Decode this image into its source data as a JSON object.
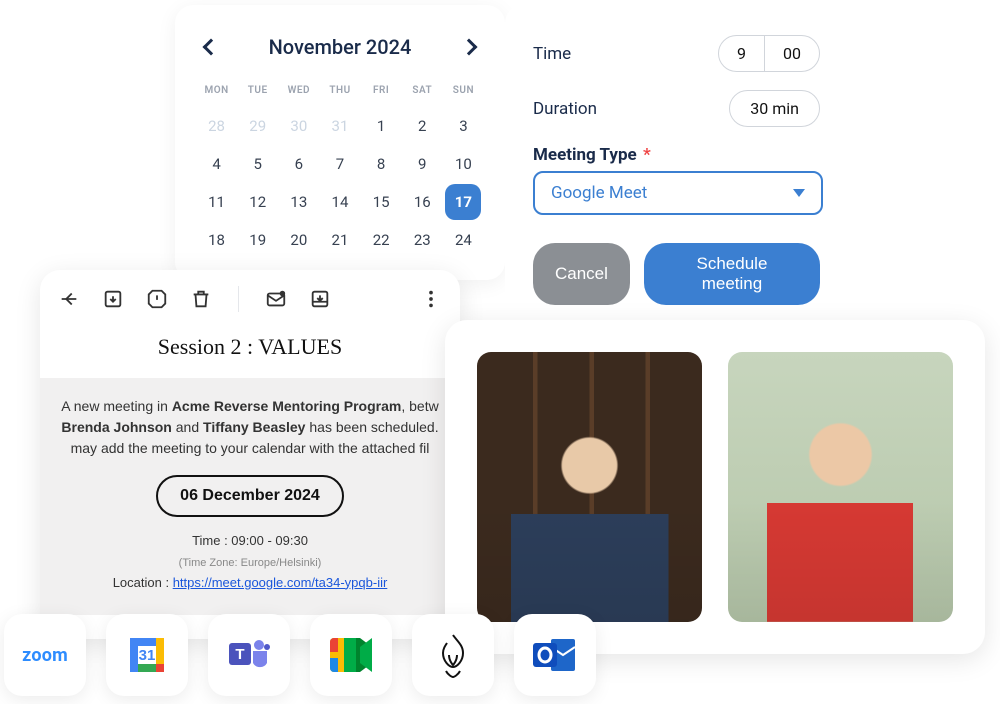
{
  "calendar": {
    "month_label": "November 2024",
    "dow": [
      "MON",
      "TUE",
      "WED",
      "THU",
      "FRI",
      "SAT",
      "SUN"
    ],
    "cells": [
      {
        "n": "28",
        "muted": true
      },
      {
        "n": "29",
        "muted": true
      },
      {
        "n": "30",
        "muted": true
      },
      {
        "n": "31",
        "muted": true
      },
      {
        "n": "1"
      },
      {
        "n": "2"
      },
      {
        "n": "3"
      },
      {
        "n": "4"
      },
      {
        "n": "5"
      },
      {
        "n": "6"
      },
      {
        "n": "7"
      },
      {
        "n": "8"
      },
      {
        "n": "9"
      },
      {
        "n": "10"
      },
      {
        "n": "11"
      },
      {
        "n": "12"
      },
      {
        "n": "13"
      },
      {
        "n": "14"
      },
      {
        "n": "15"
      },
      {
        "n": "16"
      },
      {
        "n": "17",
        "selected": true
      },
      {
        "n": "18"
      },
      {
        "n": "19"
      },
      {
        "n": "20"
      },
      {
        "n": "21"
      },
      {
        "n": "22"
      },
      {
        "n": "23"
      },
      {
        "n": "24"
      }
    ]
  },
  "form": {
    "time_label": "Time",
    "hour": "9",
    "minute": "00",
    "duration_label": "Duration",
    "duration_value": "30 min",
    "meeting_type_label": "Meeting Type",
    "meeting_type_value": "Google Meet",
    "cancel_label": "Cancel",
    "schedule_label": "Schedule meeting"
  },
  "email": {
    "title": "Session 2 : VALUES",
    "line1_pre": "A new meeting in ",
    "program_name": "Acme Reverse Mentoring Program",
    "line1_post": ", betw",
    "person_a": "Brenda Johnson",
    "and_word": " and ",
    "person_b": "Tiffany Beasley",
    "line2_post": " has been scheduled.",
    "line3": "may add the meeting to your calendar with the attached fil",
    "date_pill": "06 December 2024",
    "time_line": "Time : 09:00 - 09:30",
    "tz_line": "(Time Zone: Europe/Helsinki)",
    "location_label": "Location : ",
    "location_url": "https://meet.google.com/ta34-ypqb-iir"
  },
  "apps": {
    "zoom": "zoom",
    "gcal_day": "31"
  }
}
